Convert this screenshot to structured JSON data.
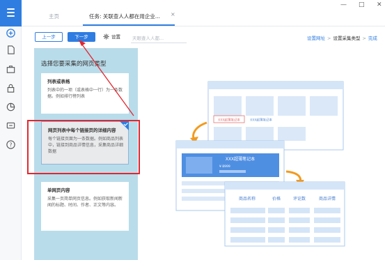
{
  "tabs": {
    "home": "主页",
    "task": "任务: 关联查人人都在用企业...",
    "close": "×"
  },
  "window": {
    "minimize": "—",
    "maximize": "□",
    "close": "✕"
  },
  "toolbar": {
    "prev_label": "上一步",
    "next_label": "下一步",
    "settings_label": "设置",
    "task_name_placeholder": "天眼查人人都..."
  },
  "breadcrumb": {
    "step1": "设置网址",
    "step2": "设置采集类型",
    "step3": "完成",
    "sep": ">"
  },
  "panel": {
    "title": "选择您要采集的网页类型",
    "cards": [
      {
        "title": "列表或表格",
        "desc": "列表中的一项（或表格中一行）为一条数据。例如排行榜列表"
      },
      {
        "title": "网页列表中每个链接页的详细内容",
        "desc": "每个链接页面为一条数据。例如商品列表中，链接到商品详情信息，采集商品详细数据"
      },
      {
        "title": "单网页内容",
        "desc": "采集一页简单网页信息。例如获取新闻新闻的标题、时间、作者、正文等内容。"
      }
    ]
  },
  "illustration": {
    "tag_left": "XXX超薄笔记本",
    "tag_right": "XXX超薄笔记本",
    "product_title": "XXX超薄笔记本",
    "price": "¥ 8999",
    "table_headers": [
      "商品名称",
      "价格",
      "评论数",
      "商品详情"
    ]
  },
  "colors": {
    "accent": "#2f7de1",
    "panel_bg": "#b9dcea",
    "highlight": "#e2262f",
    "arrow_orange": "#f39a1f"
  },
  "icons": {
    "rail": [
      "menu-icon",
      "add-circle-icon",
      "document-icon",
      "briefcase-icon",
      "lock-icon",
      "pie-chart-icon",
      "chat-icon",
      "help-icon"
    ],
    "toolbar": [
      "gear-icon"
    ]
  }
}
